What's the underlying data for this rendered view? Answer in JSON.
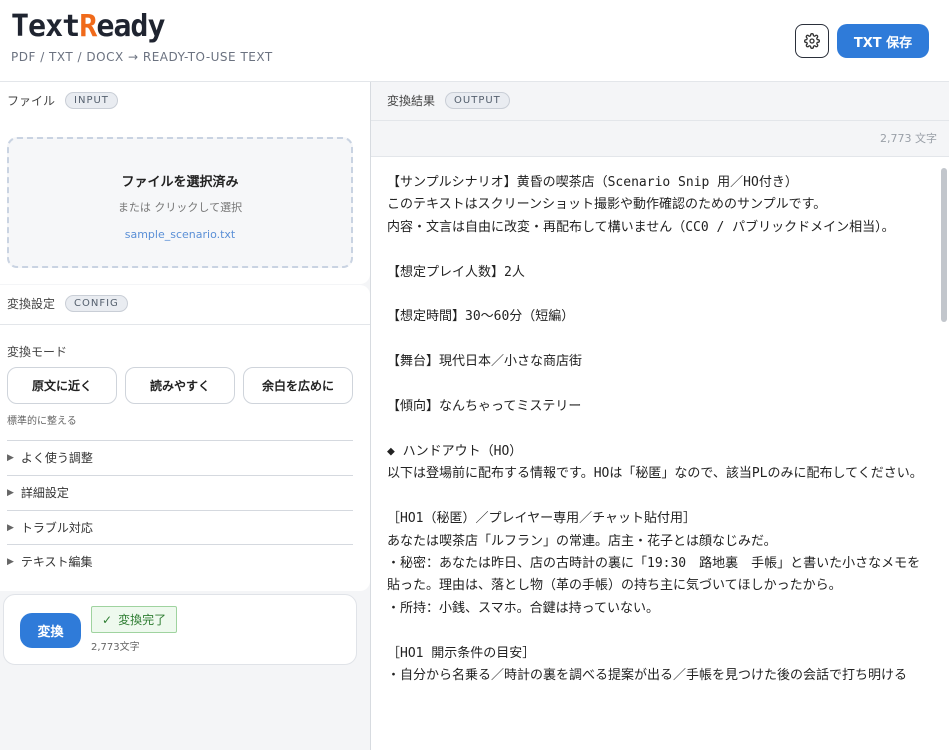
{
  "header": {
    "logo_prefix": "Text",
    "logo_accent": "R",
    "logo_suffix": "eady",
    "tagline": "PDF / TXT / DOCX → READY-TO-USE TEXT",
    "settings_icon": "gear-icon",
    "save_label": "TXT 保存",
    "save_color": "#2f7bd9",
    "logo_accent_color": "#f06a1a"
  },
  "file_panel": {
    "title": "ファイル",
    "badge": "INPUT",
    "dropzone_title": "ファイルを選択済み",
    "dropzone_sub": "または クリックして選択",
    "file_name": "sample_scenario.txt"
  },
  "config_panel": {
    "title": "変換設定",
    "badge": "CONFIG",
    "mode_label": "変換モード",
    "modes": [
      "原文に近く",
      "読みやすく",
      "余白を広めに"
    ],
    "mode_hint": "標準的に整える",
    "accordion": [
      "よく使う調整",
      "詳細設定",
      "トラブル対応",
      "テキスト編集"
    ]
  },
  "convert": {
    "button": "変換",
    "status": "変換完了",
    "status_icon": "check-icon",
    "count": "2,773文字"
  },
  "output_panel": {
    "title": "変換結果",
    "badge": "OUTPUT",
    "char_count": "2,773 文字",
    "text": "【サンプルシナリオ】黄昏の喫茶店（Scenario Snip 用／HO付き）\nこのテキストはスクリーンショット撮影や動作確認のためのサンプルです。\n内容・文言は自由に改変・再配布して構いません（CC0 / パブリックドメイン相当）。\n\n【想定プレイ人数】2人\n\n【想定時間】30〜60分（短編）\n\n【舞台】現代日本／小さな商店街\n\n【傾向】なんちゃってミステリー\n\n◆ ハンドアウト（HO）\n以下は登場前に配布する情報です。HOは「秘匿」なので、該当PLのみに配布してください。\n\n［HO1（秘匿）／プレイヤー専用／チャット貼付用］\nあなたは喫茶店「ルフラン」の常連。店主・花子とは顔なじみだ。\n・秘密：あなたは昨日、店の古時計の裏に「19:30　路地裏　手帳」と書いた小さなメモを貼った。理由は、落とし物（革の手帳）の持ち主に気づいてほしかったから。\n・所持：小銭、スマホ。合鍵は持っていない。\n\n［HO1 開示条件の目安］\n・自分から名乗る／時計の裏を調べる提案が出る／手帳を見つけた後の会話で打ち明ける"
  }
}
